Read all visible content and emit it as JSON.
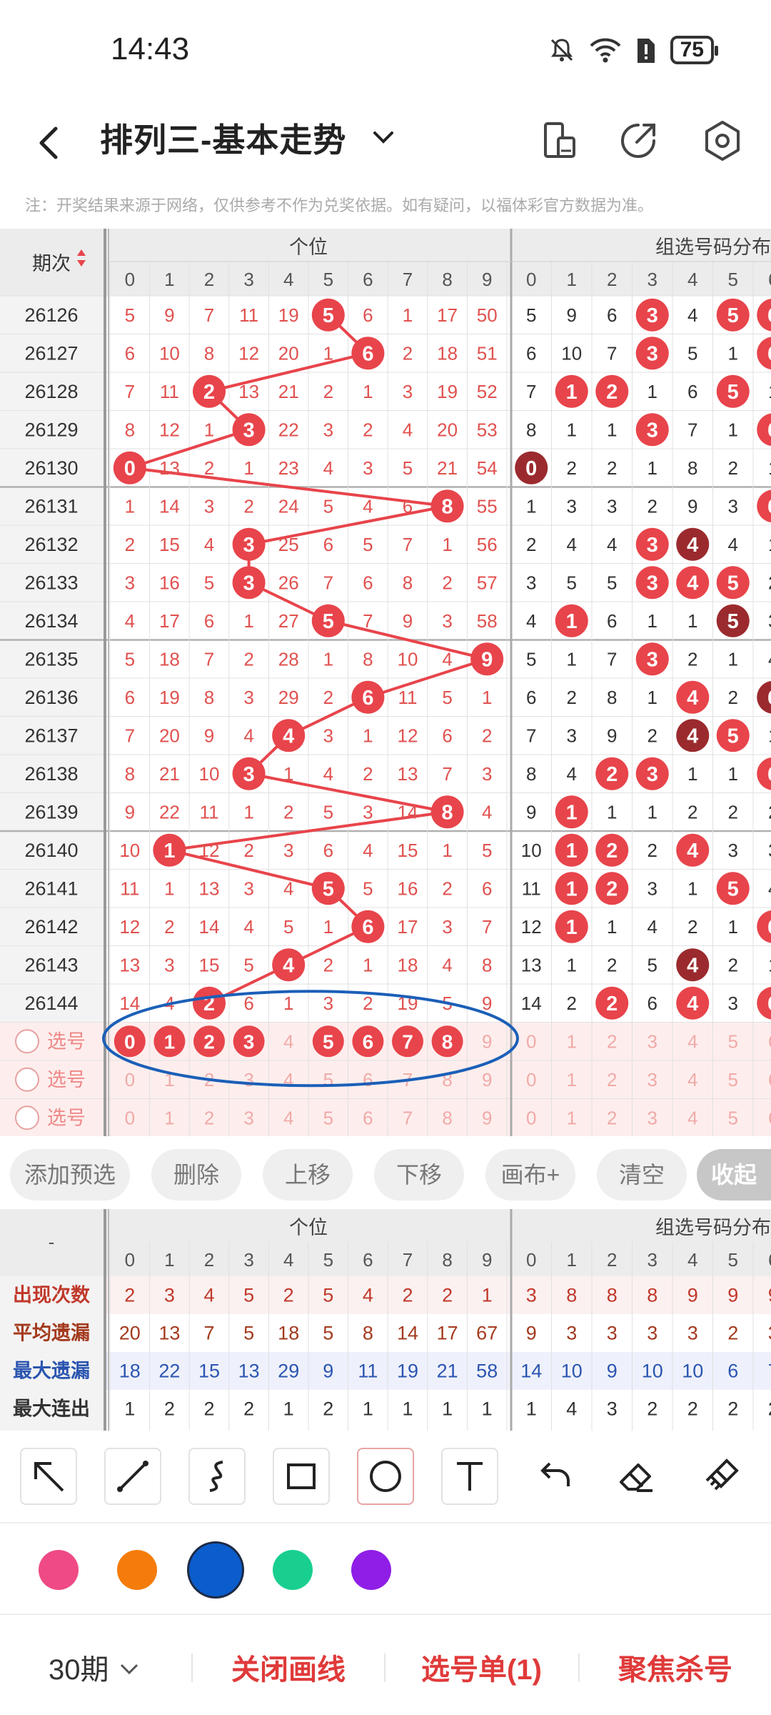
{
  "status": {
    "time": "14:43",
    "battery": "75"
  },
  "header": {
    "title": "排列三-基本走势"
  },
  "notice": "注：开奖结果来源于网络，仅供参考不作为兑奖依据。如有疑问，以福体彩官方数据为准。",
  "colors": {
    "red": "#e8444b",
    "dark_red": "#9b2a2e",
    "blue_circle": "#1b5fb8",
    "line": "#e8444b"
  },
  "table": {
    "period_header": "期次",
    "section_unit": "个位",
    "section_group": "组选号码分布",
    "digits": [
      "0",
      "1",
      "2",
      "3",
      "4",
      "5",
      "6",
      "7",
      "8",
      "9"
    ],
    "rows": [
      {
        "period": "26126",
        "unit": [
          "5",
          "9",
          "7",
          "11",
          "19",
          "5",
          "6",
          "1",
          "17",
          "50"
        ],
        "hit": 5,
        "group": [
          "5",
          "9",
          "6",
          "3",
          "4",
          "5",
          "6"
        ],
        "ghits": [
          3,
          5,
          6
        ],
        "dark": []
      },
      {
        "period": "26127",
        "unit": [
          "6",
          "10",
          "8",
          "12",
          "20",
          "1",
          "6",
          "2",
          "18",
          "51"
        ],
        "hit": 6,
        "group": [
          "6",
          "10",
          "7",
          "3",
          "5",
          "1",
          "6"
        ],
        "ghits": [
          3,
          6
        ],
        "dark": []
      },
      {
        "period": "26128",
        "unit": [
          "7",
          "11",
          "2",
          "13",
          "21",
          "2",
          "1",
          "3",
          "19",
          "52"
        ],
        "hit": 2,
        "group": [
          "7",
          "1",
          "2",
          "1",
          "6",
          "5",
          "1"
        ],
        "ghits": [
          1,
          2,
          5
        ],
        "dark": []
      },
      {
        "period": "26129",
        "unit": [
          "8",
          "12",
          "1",
          "3",
          "22",
          "3",
          "2",
          "4",
          "20",
          "53"
        ],
        "hit": 3,
        "group": [
          "8",
          "1",
          "1",
          "3",
          "7",
          "1",
          "6"
        ],
        "ghits": [
          3,
          6
        ],
        "dark": []
      },
      {
        "period": "26130",
        "unit": [
          "0",
          "13",
          "2",
          "1",
          "23",
          "4",
          "3",
          "5",
          "21",
          "54"
        ],
        "hit": 0,
        "group": [
          "0",
          "2",
          "2",
          "1",
          "8",
          "2",
          "1"
        ],
        "ghits": [
          0
        ],
        "dark": [
          0
        ]
      },
      {
        "period": "26131",
        "unit": [
          "1",
          "14",
          "3",
          "2",
          "24",
          "5",
          "4",
          "6",
          "8",
          "55"
        ],
        "hit": 8,
        "group": [
          "1",
          "3",
          "3",
          "2",
          "9",
          "3",
          "6"
        ],
        "ghits": [
          6
        ],
        "dark": []
      },
      {
        "period": "26132",
        "unit": [
          "2",
          "15",
          "4",
          "3",
          "25",
          "6",
          "5",
          "7",
          "1",
          "56"
        ],
        "hit": 3,
        "group": [
          "2",
          "4",
          "4",
          "3",
          "4",
          "4",
          "1"
        ],
        "ghits": [
          3,
          4
        ],
        "dark": [
          4
        ]
      },
      {
        "period": "26133",
        "unit": [
          "3",
          "16",
          "5",
          "3",
          "26",
          "7",
          "6",
          "8",
          "2",
          "57"
        ],
        "hit": 3,
        "group": [
          "3",
          "5",
          "5",
          "3",
          "4",
          "5",
          "2"
        ],
        "ghits": [
          3,
          4,
          5
        ],
        "dark": []
      },
      {
        "period": "26134",
        "unit": [
          "4",
          "17",
          "6",
          "1",
          "27",
          "5",
          "7",
          "9",
          "3",
          "58"
        ],
        "hit": 5,
        "group": [
          "4",
          "1",
          "6",
          "1",
          "1",
          "5",
          "3"
        ],
        "ghits": [
          1,
          5
        ],
        "dark": [
          5
        ]
      },
      {
        "period": "26135",
        "unit": [
          "5",
          "18",
          "7",
          "2",
          "28",
          "1",
          "8",
          "10",
          "4",
          "9"
        ],
        "hit": 9,
        "group": [
          "5",
          "1",
          "7",
          "3",
          "2",
          "1",
          "4"
        ],
        "ghits": [
          3
        ],
        "dark": []
      },
      {
        "period": "26136",
        "unit": [
          "6",
          "19",
          "8",
          "3",
          "29",
          "2",
          "6",
          "11",
          "5",
          "1"
        ],
        "hit": 6,
        "group": [
          "6",
          "2",
          "8",
          "1",
          "4",
          "2",
          "6"
        ],
        "ghits": [
          4,
          6
        ],
        "dark": [
          6
        ]
      },
      {
        "period": "26137",
        "unit": [
          "7",
          "20",
          "9",
          "4",
          "4",
          "3",
          "1",
          "12",
          "6",
          "2"
        ],
        "hit": 4,
        "group": [
          "7",
          "3",
          "9",
          "2",
          "4",
          "5",
          "1"
        ],
        "ghits": [
          4,
          5
        ],
        "dark": [
          4
        ]
      },
      {
        "period": "26138",
        "unit": [
          "8",
          "21",
          "10",
          "3",
          "1",
          "4",
          "2",
          "13",
          "7",
          "3"
        ],
        "hit": 3,
        "group": [
          "8",
          "4",
          "2",
          "3",
          "1",
          "1",
          "6"
        ],
        "ghits": [
          2,
          3,
          6
        ],
        "dark": []
      },
      {
        "period": "26139",
        "unit": [
          "9",
          "22",
          "11",
          "1",
          "2",
          "5",
          "3",
          "14",
          "8",
          "4"
        ],
        "hit": 8,
        "group": [
          "9",
          "1",
          "1",
          "1",
          "2",
          "2",
          "2"
        ],
        "ghits": [
          1
        ],
        "dark": []
      },
      {
        "period": "26140",
        "unit": [
          "10",
          "1",
          "12",
          "2",
          "3",
          "6",
          "4",
          "15",
          "1",
          "5"
        ],
        "hit": 1,
        "group": [
          "10",
          "1",
          "2",
          "2",
          "4",
          "3",
          "3"
        ],
        "ghits": [
          1,
          2,
          4
        ],
        "dark": []
      },
      {
        "period": "26141",
        "unit": [
          "11",
          "1",
          "13",
          "3",
          "4",
          "5",
          "5",
          "16",
          "2",
          "6"
        ],
        "hit": 5,
        "group": [
          "11",
          "1",
          "2",
          "3",
          "1",
          "5",
          "4"
        ],
        "ghits": [
          1,
          2,
          5
        ],
        "dark": []
      },
      {
        "period": "26142",
        "unit": [
          "12",
          "2",
          "14",
          "4",
          "5",
          "1",
          "6",
          "17",
          "3",
          "7"
        ],
        "hit": 6,
        "group": [
          "12",
          "1",
          "1",
          "4",
          "2",
          "1",
          "6"
        ],
        "ghits": [
          1,
          6
        ],
        "dark": []
      },
      {
        "period": "26143",
        "unit": [
          "13",
          "3",
          "15",
          "5",
          "4",
          "2",
          "1",
          "18",
          "4",
          "8"
        ],
        "hit": 4,
        "group": [
          "13",
          "1",
          "2",
          "5",
          "4",
          "2",
          "1"
        ],
        "ghits": [
          4
        ],
        "dark": [
          4
        ]
      },
      {
        "period": "26144",
        "unit": [
          "14",
          "4",
          "2",
          "6",
          "1",
          "3",
          "2",
          "19",
          "5",
          "9"
        ],
        "hit": 2,
        "group": [
          "14",
          "2",
          "2",
          "6",
          "4",
          "3",
          "6"
        ],
        "ghits": [
          2,
          4,
          6
        ],
        "dark": []
      }
    ],
    "pick_label": "选号",
    "pick_selected": [
      0,
      1,
      2,
      3,
      5,
      6,
      7,
      8
    ]
  },
  "actions": [
    "添加预选",
    "删除",
    "上移",
    "下移",
    "画布+",
    "清空",
    "收起"
  ],
  "stats": {
    "corner": "-",
    "section_unit": "个位",
    "section_group": "组选号码分布",
    "rows": [
      {
        "label": "出现次数",
        "unit": [
          "2",
          "3",
          "4",
          "5",
          "2",
          "5",
          "4",
          "2",
          "2",
          "1"
        ],
        "group": [
          "3",
          "8",
          "8",
          "8",
          "9",
          "9",
          "9"
        ],
        "color": "#c0392b"
      },
      {
        "label": "平均遗漏",
        "unit": [
          "20",
          "13",
          "7",
          "5",
          "18",
          "5",
          "8",
          "14",
          "17",
          "67"
        ],
        "group": [
          "9",
          "3",
          "3",
          "3",
          "3",
          "2",
          "3"
        ],
        "color": "#a33a1e"
      },
      {
        "label": "最大遗漏",
        "unit": [
          "18",
          "22",
          "15",
          "13",
          "29",
          "9",
          "11",
          "19",
          "21",
          "58"
        ],
        "group": [
          "14",
          "10",
          "9",
          "10",
          "10",
          "6",
          "7"
        ],
        "color": "#2b55b0"
      },
      {
        "label": "最大连出",
        "unit": [
          "1",
          "2",
          "2",
          "2",
          "1",
          "2",
          "1",
          "1",
          "1",
          "1"
        ],
        "group": [
          "1",
          "4",
          "3",
          "2",
          "2",
          "2",
          "2"
        ],
        "color": "#333"
      }
    ]
  },
  "draw_tools": [
    "arrow-tool",
    "line-tool",
    "curve-tool",
    "rectangle-tool",
    "circle-tool",
    "text-tool",
    "undo-tool",
    "eraser-tool",
    "clear-tool"
  ],
  "palette": [
    "#ef4a86",
    "#f57c0a",
    "#0b5ccc",
    "#19cf8f",
    "#8f1ee6"
  ],
  "bottom_bar": {
    "periods": "30期",
    "close_drawing": "关闭画线",
    "pick_list": "选号单(1)",
    "focus_kill": "聚焦杀号"
  }
}
